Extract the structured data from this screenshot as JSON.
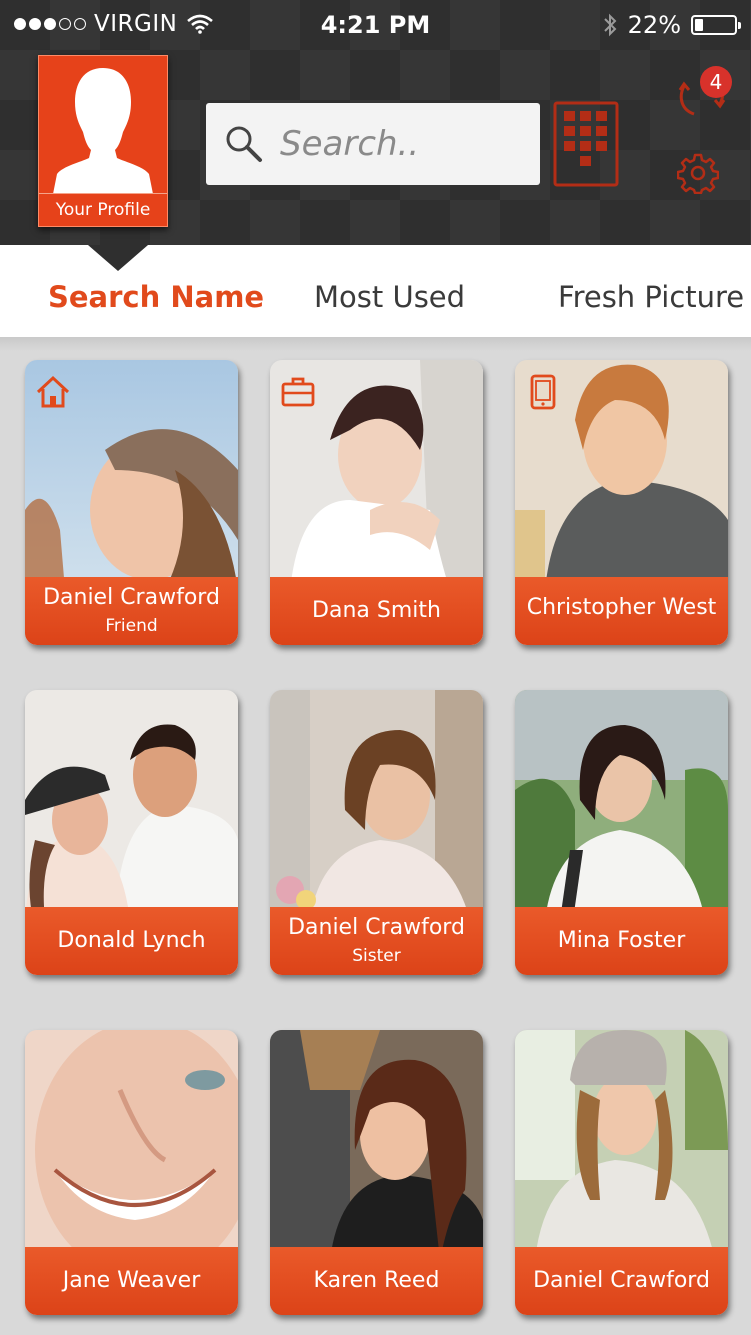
{
  "status_bar": {
    "carrier": "VIRGIN",
    "signal_bars": 3,
    "signal_max": 5,
    "time": "4:21 PM",
    "battery_percent_label": "22%",
    "battery_level": 0.22
  },
  "header": {
    "profile_label": "Your Profile",
    "search_placeholder": "Search..",
    "sync_badge_count": "4"
  },
  "tabs": [
    {
      "label": "Search Name",
      "active": true
    },
    {
      "label": "Most Used",
      "active": false
    },
    {
      "label": "Fresh Picture",
      "active": false
    }
  ],
  "contacts": [
    {
      "name": "Daniel Crawford",
      "relation": "Friend",
      "category_icon": "home-icon"
    },
    {
      "name": "Dana Smith",
      "relation": "",
      "category_icon": "briefcase-icon"
    },
    {
      "name": "Christopher West",
      "relation": "",
      "category_icon": "mobile-phone-icon"
    },
    {
      "name": "Donald Lynch",
      "relation": "",
      "category_icon": ""
    },
    {
      "name": "Daniel Crawford",
      "relation": "Sister",
      "category_icon": ""
    },
    {
      "name": "Mina Foster",
      "relation": "",
      "category_icon": ""
    },
    {
      "name": "Jane Weaver",
      "relation": "",
      "category_icon": ""
    },
    {
      "name": "Karen Reed",
      "relation": "",
      "category_icon": ""
    },
    {
      "name": "Daniel Crawford",
      "relation": "",
      "category_icon": ""
    }
  ],
  "colors": {
    "accent": "#e14a1c",
    "header_bg": "#2f2f2f",
    "card_band": "#e4501f"
  }
}
